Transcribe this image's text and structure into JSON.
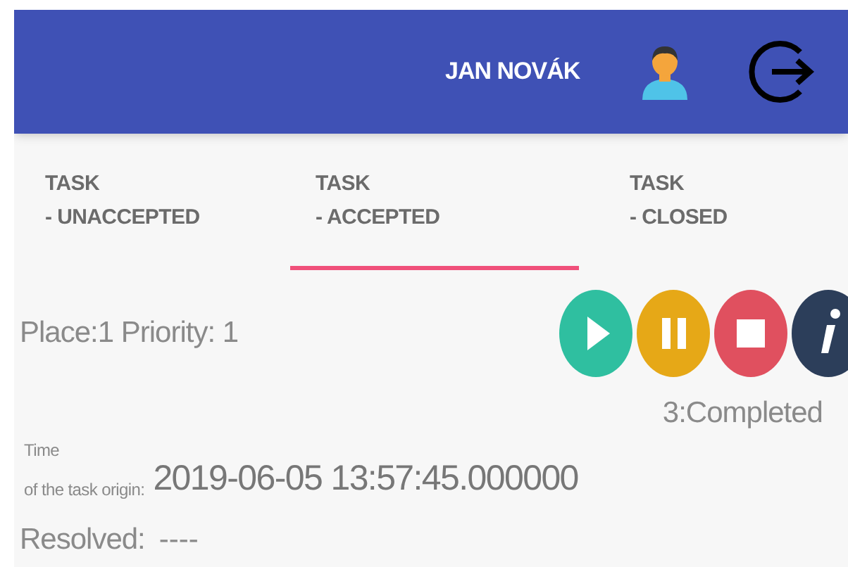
{
  "app_bar": {
    "user_name": "JAN NOVÁK"
  },
  "tabs": [
    {
      "line1": "TASK",
      "line2": "- UNACCEPTED",
      "selected": false
    },
    {
      "line1": "TASK",
      "line2": "- ACCEPTED",
      "selected": true
    },
    {
      "line1": "TASK",
      "line2": "- CLOSED",
      "selected": false
    }
  ],
  "task": {
    "place_priority": "Place:1 Priority: 1",
    "actions": [
      {
        "kind": "play"
      },
      {
        "kind": "pause"
      },
      {
        "kind": "stop"
      },
      {
        "kind": "info"
      }
    ],
    "status": "3:Completed",
    "time_label_1": "Time",
    "time_label_2": "of the task origin:",
    "time_value": "2019-06-05 13:57:45.000000",
    "resolved_label": "Resolved:",
    "resolved_value": "----"
  }
}
